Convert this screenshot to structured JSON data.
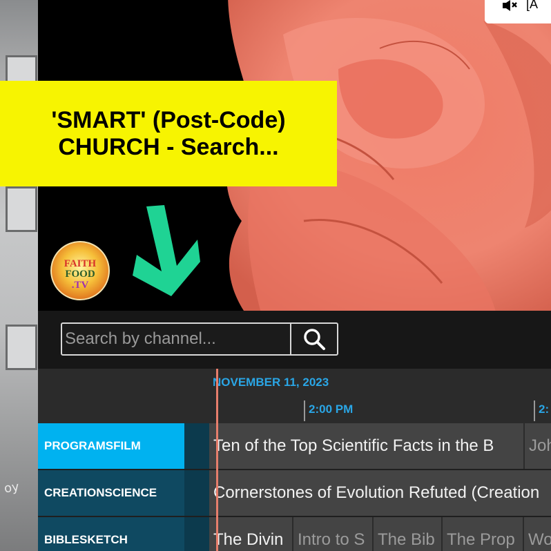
{
  "header": {
    "mute_label": "[A",
    "banner_line1": "'SMART' (Post-Code)",
    "banner_line2": "CHURCH - Search...",
    "logo_text": [
      "FAITH",
      "FOOD",
      ".TV"
    ]
  },
  "left_sign": "oy",
  "search": {
    "placeholder": "Search by channel..."
  },
  "guide": {
    "date": "NOVEMBER 11, 2023",
    "timeslots": [
      "2:00 PM",
      "2:"
    ],
    "channels": [
      {
        "name": "PROGRAMSFILM",
        "active": true,
        "programs": [
          {
            "title": "Ten of the Top Scientific Facts in the B"
          },
          {
            "title": "John"
          }
        ]
      },
      {
        "name": "CREATIONSCIENCE",
        "active": false,
        "programs": [
          {
            "title": "Cornerstones of Evolution Refuted (Creation"
          }
        ]
      },
      {
        "name": "BIBLESKETCH",
        "active": false,
        "programs": [
          {
            "title": "The Divin"
          },
          {
            "title": "Intro to S"
          },
          {
            "title": "The Bib"
          },
          {
            "title": "The Prop"
          },
          {
            "title": "Wo"
          }
        ]
      }
    ]
  },
  "colors": {
    "banner": "#f7f401",
    "accent": "#2aa6e6",
    "active_channel": "#00b2f0",
    "channel": "#0f4961",
    "arrow": "#1fd394",
    "now_line": "#e77e6c"
  }
}
